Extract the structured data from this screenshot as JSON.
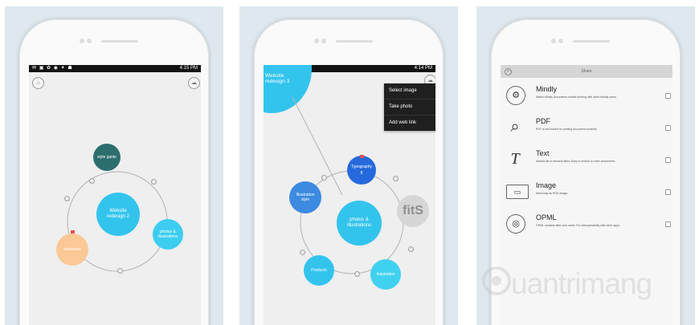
{
  "status_bar": {
    "icons": "✉ ▣ ✿ ◉ ✦ ☗",
    "panel1_time": "4:15 PM",
    "panel2_time": "4:14 PM",
    "panel3_time": ""
  },
  "panel1": {
    "home_icon": "⌂",
    "cloud_icon": "☁",
    "nodes": {
      "center": "Website redesign 2",
      "top": "style guide",
      "right": "photos & illustrations",
      "left": "wireframe"
    }
  },
  "panel2": {
    "corner_title": "Website redesign 3",
    "nodes": {
      "center": "photos & illustrations",
      "top": "Typography",
      "top_badge": "8",
      "left": "Illustration style",
      "bottom_left": "Products",
      "bottom_right": "Inspiration",
      "image_text": "fitS"
    },
    "menu": [
      "Select image",
      "Take photo",
      "Add web link"
    ]
  },
  "panel3": {
    "header": "Share",
    "items": [
      {
        "icon": "⚙",
        "title": "Mindly",
        "desc": "Native Mindly documents enable sharing with other Mindly users."
      },
      {
        "icon": "⌕",
        "title": "PDF",
        "desc": "PDF is well suited for printing document contents."
      },
      {
        "icon": "T",
        "title": "Text",
        "desc": "Nested list of element titles. Easy to embed in other documents."
      },
      {
        "icon": "▭",
        "title": "Image",
        "desc": "Mind map as PNG image."
      },
      {
        "icon": "◎",
        "title": "OPML",
        "desc": "OPML contains titles and notes. For interoperability with other apps."
      }
    ]
  },
  "watermark": "uantrimang",
  "colors": {
    "teal_dark": "#2c6e6e",
    "cyan": "#33c4ee",
    "peach": "#fbc896",
    "blue": "#2569dd",
    "cyan_light": "#41d1f0"
  }
}
